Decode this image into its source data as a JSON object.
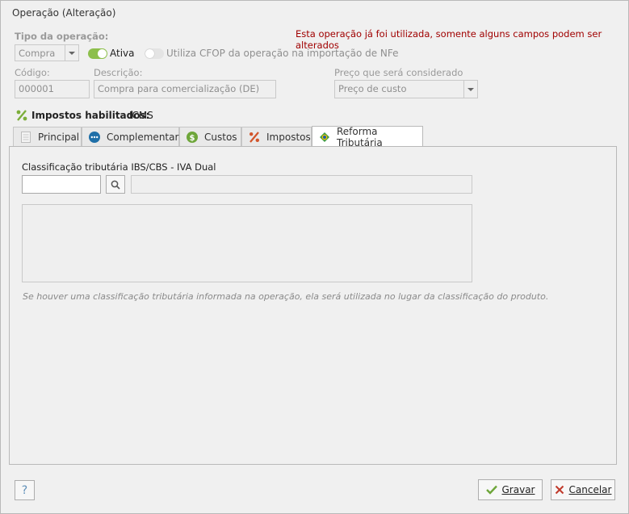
{
  "window": {
    "title": "Operação (Alteração)"
  },
  "warning": "Esta operação já foi utilizada, somente alguns campos podem ser alterados",
  "header": {
    "tipo_label": "Tipo da operação:",
    "tipo_value": "Compra",
    "ativa_label": "Ativa",
    "cfop_label": "Utiliza CFOP da operação na importação de NFe",
    "codigo_label": "Código:",
    "codigo_value": "000001",
    "descricao_label": "Descrição:",
    "descricao_value": "Compra para comercialização (DE)",
    "preco_label": "Preço que será considerado",
    "preco_value": "Preço de custo"
  },
  "impostos": {
    "label": "Impostos habilitados:",
    "value": "ICMS"
  },
  "tabs": [
    {
      "label": "Principal",
      "icon": "document-icon"
    },
    {
      "label": "Complementar",
      "icon": "more-icon"
    },
    {
      "label": "Custos",
      "icon": "dollar-icon"
    },
    {
      "label": "Impostos",
      "icon": "percent-icon"
    },
    {
      "label": "Reforma Tributária",
      "icon": "brazil-flag-icon"
    }
  ],
  "reforma": {
    "class_label": "Classificação tributária IBS/CBS - IVA Dual",
    "code_value": "",
    "desc_value": "",
    "hint": "Se houver uma classificação tributária informada na operação, ela será utilizada no lugar da classificação do produto."
  },
  "footer": {
    "help": "?",
    "save": "Gravar",
    "cancel": "Cancelar"
  },
  "colors": {
    "warning": "#a00000",
    "accent_green": "#8dbf4c",
    "cancel_red": "#c0392b"
  }
}
